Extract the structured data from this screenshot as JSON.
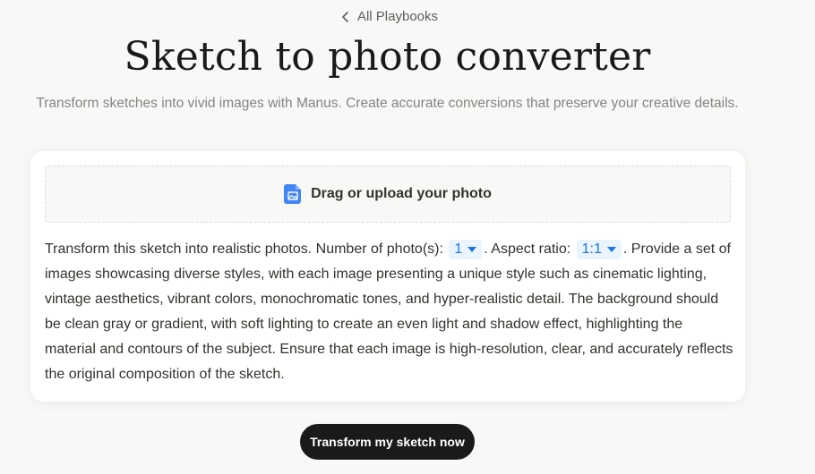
{
  "nav": {
    "back_label": "All Playbooks"
  },
  "header": {
    "title": "Sketch to photo converter",
    "subtitle": "Transform sketches into vivid images with Manus. Create accurate conversions that preserve your creative details."
  },
  "upload": {
    "label": "Drag or upload your photo"
  },
  "prompt": {
    "part1": "Transform this sketch into realistic photos. Number of photo(s): ",
    "photo_count": "1",
    "part2": ". Aspect ratio: ",
    "aspect_ratio": "1:1",
    "part3": ". Provide a set of images showcasing diverse styles, with each image presenting a unique style such as cinematic lighting, vintage aesthetics, vibrant colors, monochromatic tones, and hyper-realistic detail. The background should be clean gray or gradient, with soft lighting to create an even light and shadow effect, highlighting the material and contours of the subject. Ensure that each image is high-resolution, clear, and accurately reflects the original composition of the sketch."
  },
  "actions": {
    "submit_label": "Transform my sketch now"
  },
  "colors": {
    "accent": "#1a73e8",
    "select_bg": "#eaf4fe",
    "button_bg": "#1a1a19",
    "file_icon": "#4285f4"
  },
  "icons": {
    "back": "chevron-left-icon",
    "upload": "image-file-icon",
    "dropdown": "caret-down-icon"
  }
}
